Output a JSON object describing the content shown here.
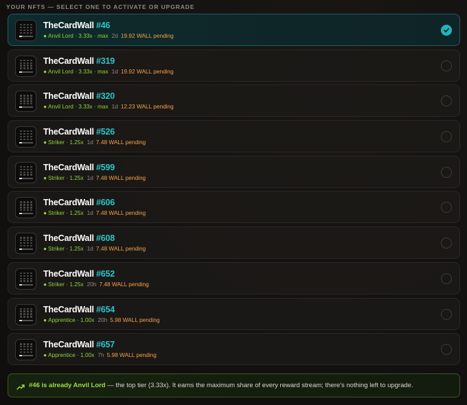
{
  "heading": "YOUR NFTS — SELECT ONE TO ACTIVATE OR UPGRADE",
  "nfts": [
    {
      "name": "TheCardWall",
      "number": "#46",
      "tier": "Anvil Lord · 3.33x · max",
      "age": "2d",
      "pending": "19.92 WALL pending",
      "selected": true
    },
    {
      "name": "TheCardWall",
      "number": "#319",
      "tier": "Anvil Lord · 3.33x · max",
      "age": "1d",
      "pending": "19.92 WALL pending",
      "selected": false
    },
    {
      "name": "TheCardWall",
      "number": "#320",
      "tier": "Anvil Lord · 3.33x · max",
      "age": "1d",
      "pending": "12.23 WALL pending",
      "selected": false
    },
    {
      "name": "TheCardWall",
      "number": "#526",
      "tier": "Striker · 1.25x",
      "age": "1d",
      "pending": "7.48 WALL pending",
      "selected": false
    },
    {
      "name": "TheCardWall",
      "number": "#599",
      "tier": "Striker · 1.25x",
      "age": "1d",
      "pending": "7.48 WALL pending",
      "selected": false
    },
    {
      "name": "TheCardWall",
      "number": "#606",
      "tier": "Striker · 1.25x",
      "age": "1d",
      "pending": "7.48 WALL pending",
      "selected": false
    },
    {
      "name": "TheCardWall",
      "number": "#608",
      "tier": "Striker · 1.25x",
      "age": "1d",
      "pending": "7.48 WALL pending",
      "selected": false
    },
    {
      "name": "TheCardWall",
      "number": "#652",
      "tier": "Striker · 1.25x",
      "age": "20h",
      "pending": "7.48 WALL pending",
      "selected": false
    },
    {
      "name": "TheCardWall",
      "number": "#654",
      "tier": "Apprentice · 1.00x",
      "age": "20h",
      "pending": "5.98 WALL pending",
      "selected": false
    },
    {
      "name": "TheCardWall",
      "number": "#657",
      "tier": "Apprentice · 1.00x",
      "age": "7h",
      "pending": "5.98 WALL pending",
      "selected": false
    }
  ],
  "notice": {
    "highlight": "#46 is already Anvil Lord",
    "text": " — the top tier (3.33x). It earns the maximum share of every reward stream; there's nothing left to upgrade."
  },
  "colors": {
    "accent": "#2cc4c9",
    "tier": "#8fd43c",
    "pending": "#f2a24a",
    "notice_border": "#3b5a1c"
  },
  "icons": {
    "check": "check-icon",
    "trend": "trending-up-icon",
    "thumb": "nft-thumbnail"
  }
}
